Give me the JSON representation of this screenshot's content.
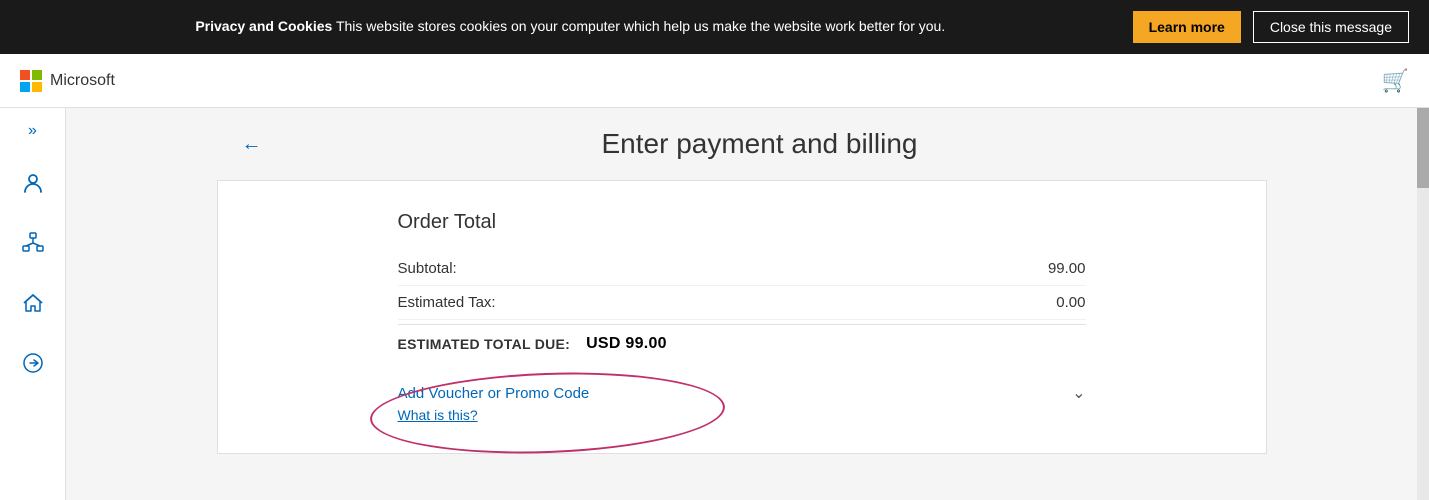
{
  "cookie_banner": {
    "text_bold": "Privacy and Cookies",
    "text_normal": " This website stores cookies on your computer which help us make the website work better for you.",
    "learn_more_label": "Learn more",
    "close_label": "Close this message"
  },
  "header": {
    "logo_text": "Microsoft",
    "cart_icon": "🛒"
  },
  "sidebar": {
    "chevron_label": "»",
    "icons": [
      "person",
      "network",
      "home",
      "arrow-right"
    ]
  },
  "main": {
    "back_arrow": "←",
    "page_title": "Enter payment and billing",
    "order_total_title": "Order Total",
    "subtotal_label": "Subtotal:",
    "subtotal_value": "99.00",
    "tax_label": "Estimated Tax:",
    "tax_value": "0.00",
    "total_label": "ESTIMATED TOTAL DUE:",
    "total_value": "USD 99.00",
    "promo_label": "Add Voucher or Promo Code",
    "what_is_this_label": "What is this?"
  }
}
